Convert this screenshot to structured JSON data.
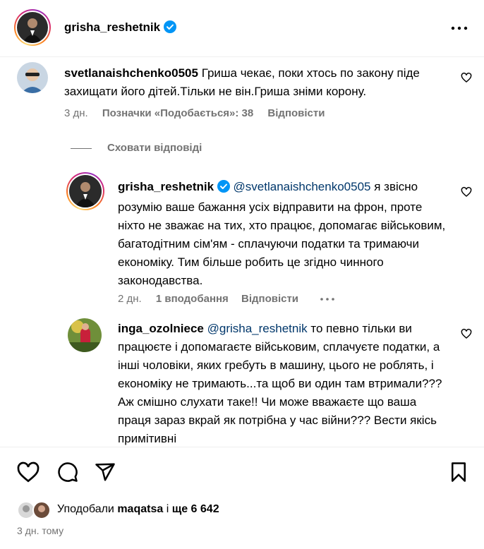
{
  "header": {
    "username": "grisha_reshetnik",
    "more_icon": "more-horizontal-icon"
  },
  "comment": {
    "username": "svetlanaishchenko0505",
    "text": "Гриша чекає, поки хтось по закону піде захищати його дітей.Тільки не він.Гриша зніми корону.",
    "time": "3 дн.",
    "likes": "Позначки «Подобається»: 38",
    "reply": "Відповісти"
  },
  "hide_replies": "Сховати відповіді",
  "replies": [
    {
      "username": "grisha_reshetnik",
      "mention": "@svetlanaishchenko0505",
      "text": "я звісно розумію ваше бажання усіх відправити на фрон, проте ніхто не зважає на тих, хто працює, допомагає військовим, багатодітним сім'ям - сплачуючи податки та тримаючи економіку. Тим більше робить це згідно чинного законодавства.",
      "time": "2 дн.",
      "likes": "1 вподобання",
      "reply": "Відповісти"
    },
    {
      "username": "inga_ozolniece",
      "mention": "@grisha_reshetnik",
      "text": "то певно тільки ви працюєте і допомагаєте військовим, сплачуєте податки, а інші чоловіки, яких гребуть в машину, цього не роблять, і економіку не тримають...та щоб ви один там втримали??? Аж смішно слухати таке!! Чи може вважаєте що ваша праця зараз вкрай як потрібна у час війни??? Вести якісь примітивні"
    }
  ],
  "footer": {
    "liked_prefix": "Уподобали",
    "liked_user": "maqatsa",
    "liked_and": "і",
    "liked_count": "ще 6 642",
    "date": "3 дн. тому"
  },
  "colors": {
    "link": "#00376b",
    "muted": "#737373",
    "verified": "#0095f6"
  }
}
